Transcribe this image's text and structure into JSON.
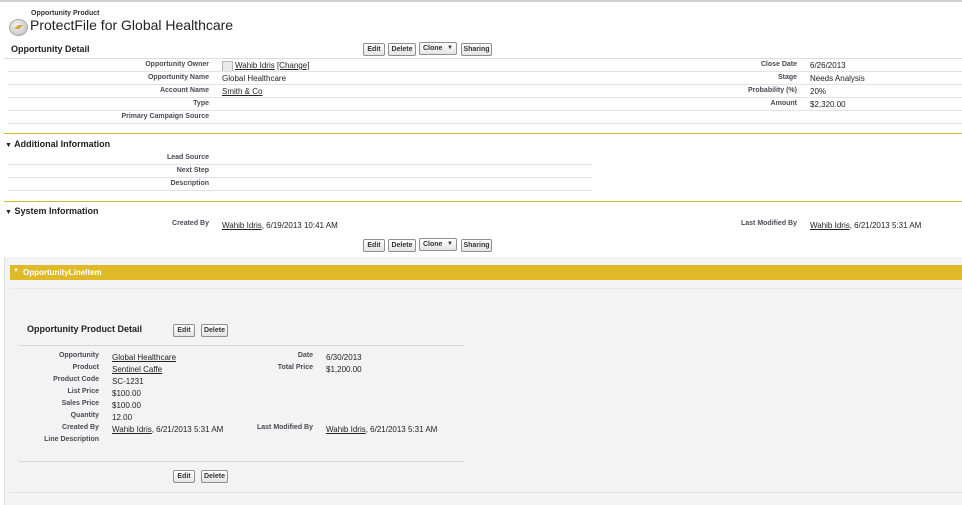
{
  "header": {
    "object_type": "Opportunity Product",
    "title": "ProtectFile for Global Healthcare"
  },
  "detail": {
    "heading": "Opportunity Detail",
    "buttons": {
      "edit": "Edit",
      "delete": "Delete",
      "clone": "Clone",
      "sharing": "Sharing"
    },
    "fields": {
      "owner_label": "Opportunity Owner",
      "owner_value": "Wahib Idris",
      "owner_change": "[Change]",
      "name_label": "Opportunity Name",
      "name_value": "Global Healthcare",
      "account_label": "Account Name",
      "account_value": "Smith & Co",
      "type_label": "Type",
      "campaign_label": "Primary Campaign Source",
      "close_date_label": "Close Date",
      "close_date_value": "6/26/2013",
      "stage_label": "Stage",
      "stage_value": "Needs Analysis",
      "probability_label": "Probability (%)",
      "probability_value": "20%",
      "amount_label": "Amount",
      "amount_value": "$2,320.00"
    }
  },
  "additional": {
    "heading": "Additional Information",
    "lead_source_label": "Lead Source",
    "next_step_label": "Next Step",
    "description_label": "Description"
  },
  "system": {
    "heading": "System Information",
    "created_label": "Created By",
    "created_user": "Wahib Idris",
    "created_date": ", 6/19/2013 10:41 AM",
    "modified_label": "Last Modified By",
    "modified_user": "Wahib Idris",
    "modified_date": ", 6/21/2013 5:31 AM"
  },
  "related": {
    "heading": "OpportunityLineItem",
    "colors": {
      "bar": "#e0b928",
      "section_line": "#d9b72b"
    }
  },
  "product_detail": {
    "heading": "Opportunity Product Detail",
    "buttons": {
      "edit": "Edit",
      "delete": "Delete"
    },
    "opportunity_label": "Opportunity",
    "opportunity_value": "Global Healthcare",
    "product_label": "Product",
    "product_value": "Sentinel Caffe",
    "code_label": "Product Code",
    "code_value": "SC-1231",
    "list_price_label": "List Price",
    "list_price_value": "$100.00",
    "sales_price_label": "Sales Price",
    "sales_price_value": "$100.00",
    "quantity_label": "Quantity",
    "quantity_value": "12.00",
    "created_label": "Created By",
    "created_user": "Wahib Idris",
    "created_date": ", 6/21/2013 5:31 AM",
    "line_desc_label": "Line Description",
    "date_label": "Date",
    "date_value": "6/30/2013",
    "total_label": "Total Price",
    "total_value": "$1,200.00",
    "modified_label": "Last Modified By",
    "modified_user": "Wahib Idris",
    "modified_date": ", 6/21/2013 5:31 AM"
  }
}
